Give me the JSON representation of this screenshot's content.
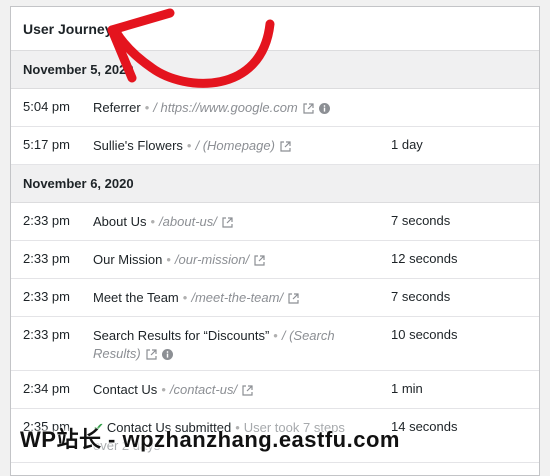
{
  "panel": {
    "title": "User Journey"
  },
  "days": [
    {
      "date": "November 5, 2020",
      "rows": [
        {
          "time": "5:04 pm",
          "page": "Referrer",
          "url": "/ https://www.google.com",
          "duration": ""
        },
        {
          "time": "5:17 pm",
          "page": "Sullie's Flowers",
          "url": "/ (Homepage)",
          "duration": "1 day"
        }
      ]
    },
    {
      "date": "November 6, 2020",
      "rows": [
        {
          "time": "2:33 pm",
          "page": "About Us",
          "url": "/about-us/",
          "duration": "7 seconds"
        },
        {
          "time": "2:33 pm",
          "page": "Our Mission",
          "url": "/our-mission/",
          "duration": "12 seconds"
        },
        {
          "time": "2:33 pm",
          "page": "Meet the Team",
          "url": "/meet-the-team/",
          "duration": "7 seconds"
        },
        {
          "time": "2:33 pm",
          "page": "Search Results for “Discounts”",
          "url": "/ (Search",
          "url2": "Results)",
          "duration": "10 seconds"
        },
        {
          "time": "2:34 pm",
          "page": "Contact Us",
          "url": "/contact-us/",
          "duration": "1 min"
        },
        {
          "time": "2:35 pm",
          "page": "Contact Us submitted",
          "note": "User took 7 steps",
          "note2": "over 2 days",
          "duration": "14 seconds"
        }
      ]
    }
  ],
  "separator": "•",
  "icons": {
    "external": "external-link-icon",
    "info": "info-icon",
    "check": "checkmark-icon"
  },
  "watermark": "WP站长 - wpzhanzhang.eastfu.com",
  "colors": {
    "arrow": "#e4141e",
    "check": "#2f9e44"
  }
}
